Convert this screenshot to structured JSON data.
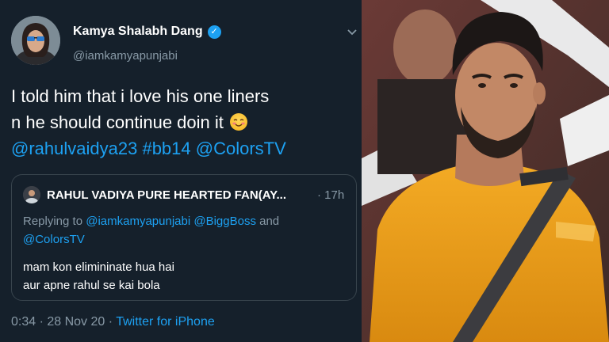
{
  "tweet": {
    "author_name": "Kamya Shalabh Dang",
    "handle": "@iamkamyapunjabi",
    "text_line1": "I told him that i love his one liners",
    "text_line2": "n he should continue doin it",
    "mention1": "@rahulvaidya23",
    "hashtag": "#bb14",
    "mention2": "@ColorsTV",
    "timestamp": "0:34 · 28 Nov 20 ·",
    "source": "Twitter for iPhone"
  },
  "quote": {
    "author_name": "RAHUL VADIYA PURE HEARTED FAN(AY...",
    "time": "· 17h",
    "replying_prefix": "Replying to",
    "replying_handle1": "@iamkamyapunjabi",
    "replying_handle2": "@BiggBoss",
    "replying_and": "and",
    "replying_handle3": "@ColorsTV",
    "text_line1": "mam kon elimininate hua hai",
    "text_line2": "aur apne rahul se kai bola"
  },
  "colors": {
    "background": "#15202b",
    "link": "#1da1f2",
    "muted": "#8899a6",
    "shirt": "#f0a21e"
  },
  "icons": [
    "verified-icon",
    "chevron-down-icon",
    "smiling-face-emoji-icon"
  ]
}
